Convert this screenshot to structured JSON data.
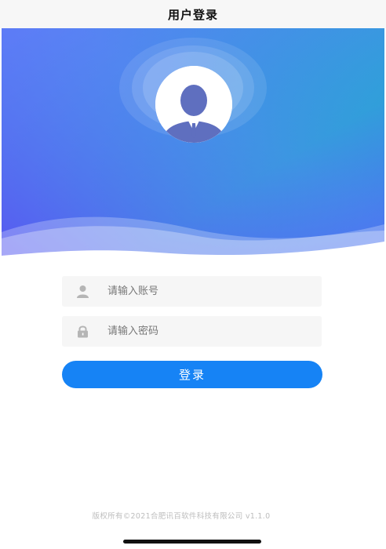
{
  "nav": {
    "title": "用户登录"
  },
  "hero": {
    "avatar_icon": "user-avatar-icon",
    "colors": {
      "gradient_start": "#5b82f7",
      "gradient_mid": "#3f97e2",
      "gradient_end": "#5a57f0"
    }
  },
  "form": {
    "account": {
      "placeholder": "请输入账号",
      "value": "",
      "icon": "user-icon"
    },
    "password": {
      "placeholder": "请输入密码",
      "value": "",
      "icon": "lock-icon"
    },
    "login_label": "登录"
  },
  "footer": {
    "copyright": "版权所有©2021合肥讯百软件科技有限公司 v1.1.0"
  },
  "theme": {
    "accent": "#1683f5",
    "field_bg": "#f6f6f6"
  }
}
